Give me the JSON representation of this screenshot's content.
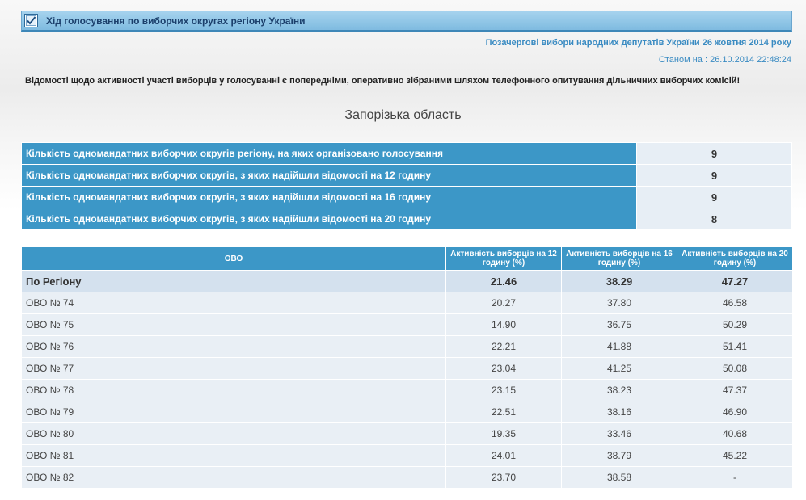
{
  "header": {
    "title": "Хід голосування по виборчих округах регіону України",
    "election": "Позачергові вибори народних депутатів України 26 жовтня 2014 року",
    "status": "Станом на : 26.10.2014 22:48:24",
    "icon": "checkbox-icon"
  },
  "notice": "Відомості щодо активності участі виборців у голосуванні є попередніми, оперативно зібраними шляхом телефонного опитування дільничних виборчих комісій!",
  "region": "Запорізька область",
  "summary": [
    {
      "label": "Кількість одномандатних виборчих округів регіону, на яких організовано голосування",
      "value": "9"
    },
    {
      "label": "Кількість одномандатних виборчих округів, з яких надійшли відомості на 12 годину",
      "value": "9"
    },
    {
      "label": "Кількість одномандатних виборчих округів, з яких надійшли відомості на 16 годину",
      "value": "9"
    },
    {
      "label": "Кількість одномандатних виборчих округів, з яких надійшли відомості на 20 годину",
      "value": "8"
    }
  ],
  "table": {
    "headers": [
      "ОВО",
      "Активність виборців на 12 годину (%)",
      "Активність виборців на 16 годину (%)",
      "Активність виборців на 20 годину (%)"
    ],
    "region_row": {
      "name": "По Регіону",
      "h12": "21.46",
      "h16": "38.29",
      "h20": "47.27"
    },
    "rows": [
      {
        "name": "ОВО № 74",
        "h12": "20.27",
        "h16": "37.80",
        "h20": "46.58"
      },
      {
        "name": "ОВО № 75",
        "h12": "14.90",
        "h16": "36.75",
        "h20": "50.29"
      },
      {
        "name": "ОВО № 76",
        "h12": "22.21",
        "h16": "41.88",
        "h20": "51.41"
      },
      {
        "name": "ОВО № 77",
        "h12": "23.04",
        "h16": "41.25",
        "h20": "50.08"
      },
      {
        "name": "ОВО № 78",
        "h12": "23.15",
        "h16": "38.23",
        "h20": "47.37"
      },
      {
        "name": "ОВО № 79",
        "h12": "22.51",
        "h16": "38.16",
        "h20": "46.90"
      },
      {
        "name": "ОВО № 80",
        "h12": "19.35",
        "h16": "33.46",
        "h20": "40.68"
      },
      {
        "name": "ОВО № 81",
        "h12": "24.01",
        "h16": "38.79",
        "h20": "45.22"
      },
      {
        "name": "ОВО № 82",
        "h12": "23.70",
        "h16": "38.58",
        "h20": "-"
      }
    ]
  },
  "colors": {
    "header_blue": "#3c97c7",
    "cell_light": "#e9eff5",
    "region_row": "#d4e1ee",
    "link_blue": "#3a8bc2"
  }
}
